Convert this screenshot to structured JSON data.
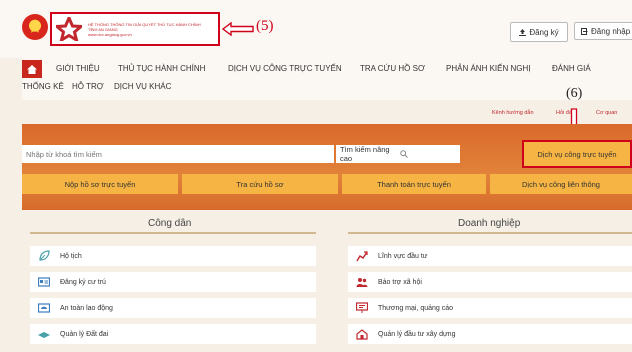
{
  "header": {
    "logo_lines": [
      "HỆ THỐNG THÔNG TIN GIẢI QUYẾT THỦ TỤC HÀNH CHÍNH",
      "TỈNH AN GIANG",
      "www.dvc.angiang.gov.vn"
    ],
    "callout_5": "(5)",
    "register_label": "Đăng ký",
    "login_label": "Đăng nhập"
  },
  "nav": {
    "row1": [
      "GIỚI THIỆU",
      "THỦ TỤC HÀNH CHÍNH",
      "DỊCH VỤ CÔNG TRỰC TUYẾN",
      "TRA CỨU HỒ SƠ",
      "PHẢN ÁNH KIẾN NGHỊ",
      "ĐÁNH GIÁ"
    ],
    "row2": [
      "THỐNG KÊ",
      "HỖ TRỢ",
      "DỊCH VỤ KHÁC"
    ]
  },
  "utility": {
    "guide": "Kênh hướng dẫn",
    "faq": "Hỏi đáp",
    "agency": "Cơ quan",
    "callout_6": "(6)"
  },
  "search": {
    "placeholder": "Nhập từ khoá tìm kiếm",
    "advanced_label": "Tìm kiếm nâng cao",
    "online_service_label": "Dịch vụ công trực tuyến"
  },
  "tiles": [
    "Nộp hồ sơ trực tuyến",
    "Tra cứu hồ sơ",
    "Thanh toán trực tuyến",
    "Dịch vụ công liên thông"
  ],
  "panels": {
    "citizen": {
      "title": "Công dân",
      "items": [
        {
          "label": "Hộ tịch",
          "icon": "leaf-icon"
        },
        {
          "label": "Đăng ký cư trú",
          "icon": "id-card-icon"
        },
        {
          "label": "An toàn lao động",
          "icon": "helmet-icon"
        },
        {
          "label": "Quản lý Đất đai",
          "icon": "land-icon"
        }
      ]
    },
    "business": {
      "title": "Doanh nghiệp",
      "items": [
        {
          "label": "Lĩnh vực đầu tư",
          "icon": "investment-icon"
        },
        {
          "label": "Bảo trợ xã hội",
          "icon": "people-icon"
        },
        {
          "label": "Thương mại, quảng cáo",
          "icon": "billboard-icon"
        },
        {
          "label": "Quản lý đầu tư xây dựng",
          "icon": "building-icon"
        }
      ]
    }
  },
  "colors": {
    "brand_red": "#c8271d",
    "annotation_red": "#d0021b",
    "banner_orange": "#e2833a",
    "tile_yellow": "#f6b444"
  }
}
